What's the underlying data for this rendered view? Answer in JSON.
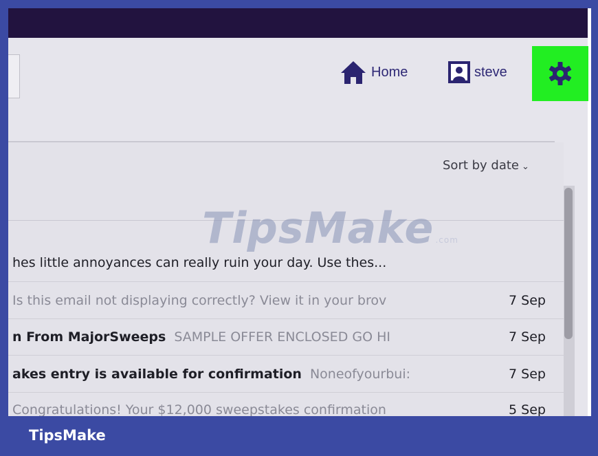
{
  "header": {
    "home_label": "Home",
    "user_label": "steve"
  },
  "toolbar": {
    "sort_label": "Sort by date",
    "sort_chevron": "⌄"
  },
  "messages": [
    {
      "sender": "",
      "subject": "hes little annoyances can really ruin your day. Use thes...",
      "snippet": "",
      "date": ""
    },
    {
      "sender": "",
      "subject": "",
      "snippet": "Is this email not displaying correctly? View it in your brov",
      "date": "7 Sep"
    },
    {
      "sender": "n From MajorSweeps",
      "subject": "",
      "snippet": "SAMPLE OFFER ENCLOSED GO HI",
      "date": "7 Sep"
    },
    {
      "sender": "akes entry is available for confirmation",
      "subject": "",
      "snippet": "Noneofyourbui:",
      "date": "7 Sep"
    },
    {
      "sender": "",
      "subject": "",
      "snippet": "Congratulations! Your $12,000 sweepstakes confirmation",
      "date": "5 Sep"
    }
  ],
  "watermark": {
    "text": "TipsMake",
    "suffix": ".com"
  },
  "banner": {
    "text": "TipsMake"
  },
  "colors": {
    "highlight": "#22ee22",
    "topbar": "#22133f",
    "accent": "#2e2875",
    "banner": "#3b4aa3"
  },
  "icons": {
    "home": "home-icon",
    "user": "user-avatar-icon",
    "settings": "gear-icon",
    "sort": "chevron-down-icon"
  }
}
